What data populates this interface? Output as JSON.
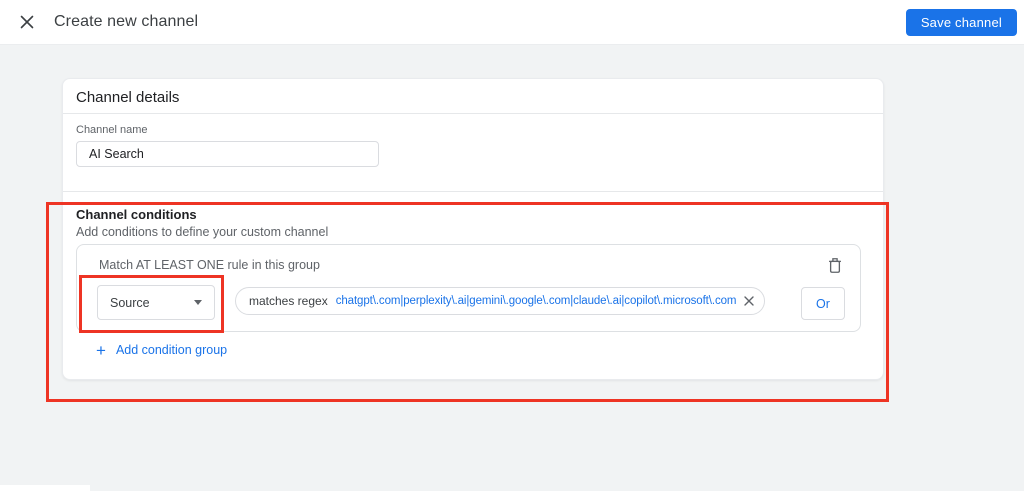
{
  "colors": {
    "accent_blue": "#1a73e8",
    "annotation_red": "#ee3424",
    "border_gray": "#dadce0",
    "text_primary": "#202124",
    "text_secondary": "#5f6368",
    "page_background": "#f1f3f4"
  },
  "header": {
    "title": "Create new channel",
    "save_button_label": "Save channel"
  },
  "icons": {
    "close": "x-close",
    "trash": "trash-outline",
    "chevron": "chevron-down",
    "remove_chip": "x-remove",
    "add": "+"
  },
  "channel_details": {
    "section_title": "Channel details",
    "channel_name_label": "Channel name",
    "channel_name_value": "AI Search"
  },
  "channel_conditions": {
    "section_title": "Channel conditions",
    "section_subtitle": "Add conditions to define your custom channel",
    "group": {
      "match_label": "Match AT LEAST ONE rule in this group",
      "rule": {
        "dimension": "Source",
        "operator": "matches regex",
        "value": "chatgpt\\.com|perplexity\\.ai|gemini\\.google\\.com|claude\\.ai|copilot\\.microsoft\\.com",
        "or_button_label": "Or"
      }
    },
    "add_condition_group_label": "Add condition group"
  }
}
